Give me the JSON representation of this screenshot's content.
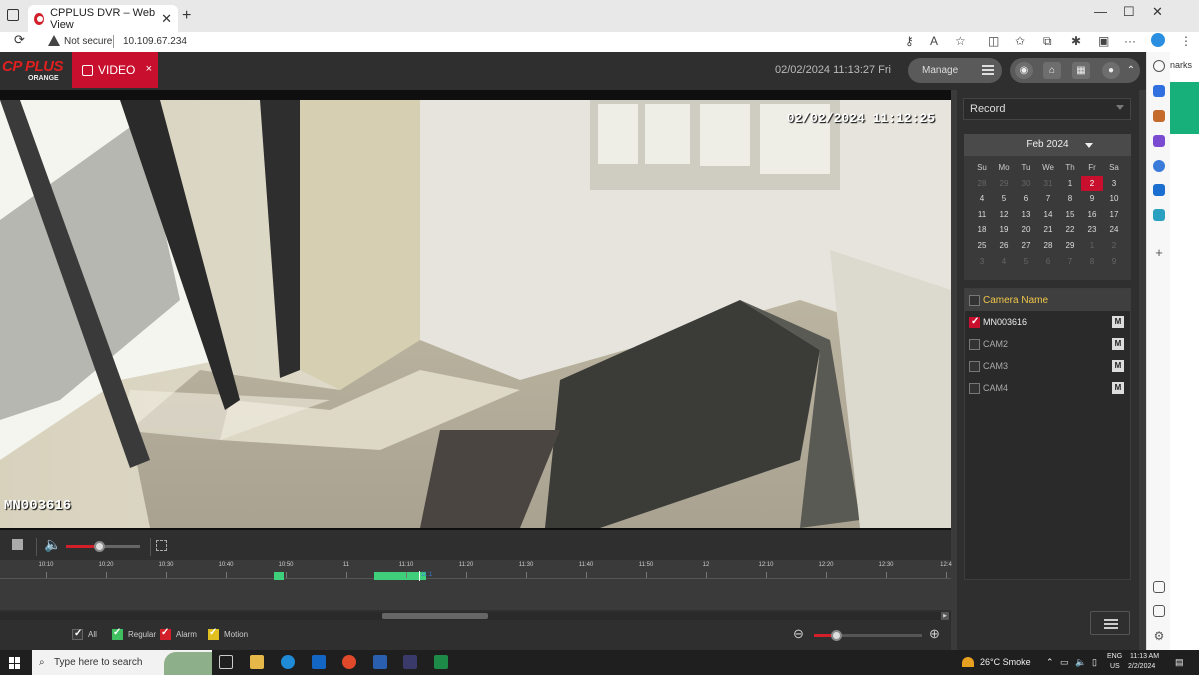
{
  "browser": {
    "tab_title": "CPPLUS DVR – Web View",
    "close": "✕",
    "new_tab": "+",
    "security_label": "Not secure",
    "url": "10.109.67.234",
    "minimize": "—",
    "maximize": "☐",
    "close_window": "✕",
    "more": "···",
    "side_partial": "narks"
  },
  "app": {
    "logo_line1": "CP PLUS",
    "logo_line2": "ORANGE",
    "video_tab": "VIDEO",
    "video_tab_close": "×",
    "datetime": "02/02/2024 11:13:27 Fri",
    "manage_label": "Manage"
  },
  "video": {
    "osd_timestamp": "02/02/2024 11:12:25",
    "osd_camera": "MN003616"
  },
  "controls": {
    "volume_level": 0.45,
    "zoom_level": 0.2
  },
  "timeline": {
    "ticks": [
      "10:10",
      "10:20",
      "10:30",
      "10:40",
      "10:50",
      "11",
      "11:10",
      "11:20",
      "11:30",
      "11:40",
      "11:50",
      "12",
      "12:10",
      "12:20",
      "12:30",
      "12:4"
    ],
    "cursor_label": "11:1"
  },
  "legend": {
    "all": "All",
    "regular": "Regular",
    "alarm": "Alarm",
    "motion": "Motion",
    "colors": {
      "regular": "#3fbf5f",
      "alarm": "#d21f2a",
      "motion": "#e0c020"
    }
  },
  "record": {
    "select_label": "Record"
  },
  "calendar": {
    "month_label": "Feb 2024",
    "weekdays": [
      "Su",
      "Mo",
      "Tu",
      "We",
      "Th",
      "Fr",
      "Sa"
    ],
    "selected_day": "2",
    "days": [
      [
        "28",
        "29",
        "30",
        "31",
        "1",
        "2",
        "3"
      ],
      [
        "4",
        "5",
        "6",
        "7",
        "8",
        "9",
        "10"
      ],
      [
        "11",
        "12",
        "13",
        "14",
        "15",
        "16",
        "17"
      ],
      [
        "18",
        "19",
        "20",
        "21",
        "22",
        "23",
        "24"
      ],
      [
        "25",
        "26",
        "27",
        "28",
        "29",
        "1",
        "2"
      ],
      [
        "3",
        "4",
        "5",
        "6",
        "7",
        "8",
        "9"
      ]
    ]
  },
  "cameras": {
    "header": "Camera Name",
    "items": [
      {
        "name": "MN003616",
        "checked": true,
        "mode": "M"
      },
      {
        "name": "CAM2",
        "checked": false,
        "mode": "M"
      },
      {
        "name": "CAM3",
        "checked": false,
        "mode": "M"
      },
      {
        "name": "CAM4",
        "checked": false,
        "mode": "M"
      }
    ]
  },
  "taskbar": {
    "search_placeholder": "Type here to search",
    "weather": "26°C  Smoke",
    "lang_top": "ENG",
    "lang_bottom": "US",
    "time": "11:13 AM",
    "date": "2/2/2024"
  }
}
